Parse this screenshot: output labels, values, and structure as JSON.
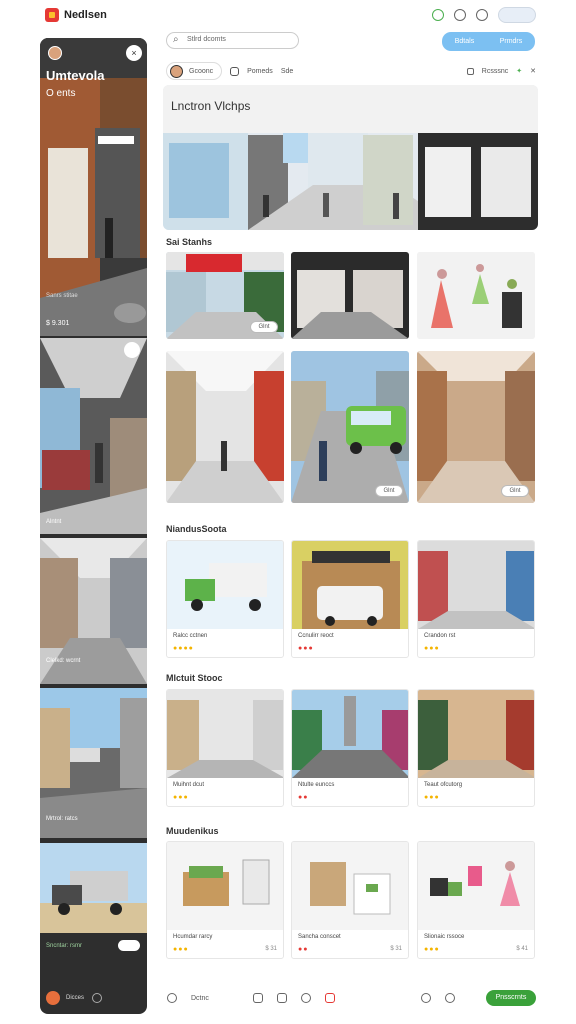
{
  "app": {
    "title": "Nedlsen"
  },
  "sidebar": {
    "header_title": "Umtevola",
    "header_subtitle": "O ents",
    "card1_caption": "Sanrs stitae",
    "card1_price": "$ 9.301",
    "card2_caption": "Alntnt",
    "card3_caption": "Clelkd: wcrnt",
    "card4_caption": "Mrtrol: ratcs",
    "card5_caption": "Sncntar: rsmr",
    "footer_label": "Dicces"
  },
  "search": {
    "placeholder": "Stlrd dcomts"
  },
  "top_buttons": [
    "Bdtals",
    "Prmdrs"
  ],
  "filter": {
    "chip1": "Gcoonc",
    "chip2": "Pomeds",
    "chip3": "Sde",
    "right_label": "Rcsssnc"
  },
  "hero": {
    "title": "Lnctron Vlchps"
  },
  "sections": {
    "s1": "Sai Stanhs",
    "s2": "NiandusSoota",
    "s3": "Mlctuit Stooc",
    "s4": "Muudenikus"
  },
  "tile_btn": "Glnt",
  "products": {
    "row1": [
      {
        "name": "Ralcc cctnen",
        "meta": ""
      },
      {
        "name": "Ccnulirr reoct",
        "meta": ""
      },
      {
        "name": "Crandon rst",
        "meta": ""
      }
    ],
    "row2": [
      {
        "name": "Muihnt dcut",
        "meta": ""
      },
      {
        "name": "Ntulte eunccs",
        "meta": ""
      },
      {
        "name": "Teaut ofcutorg",
        "meta": ""
      }
    ],
    "row3": [
      {
        "name": "Hcumdar rarcy",
        "meta": "$ 31"
      },
      {
        "name": "Sancha conscet",
        "meta": "$ 31"
      },
      {
        "name": "Slionaic rssoce",
        "meta": "$ 41"
      }
    ]
  },
  "bottom": {
    "label": "Dctnc",
    "cta": "Pnsscrnts"
  },
  "colors": {
    "accent": "#7cc0f2",
    "cta": "#3aa13a",
    "sidebar": "#2e2e2e"
  }
}
